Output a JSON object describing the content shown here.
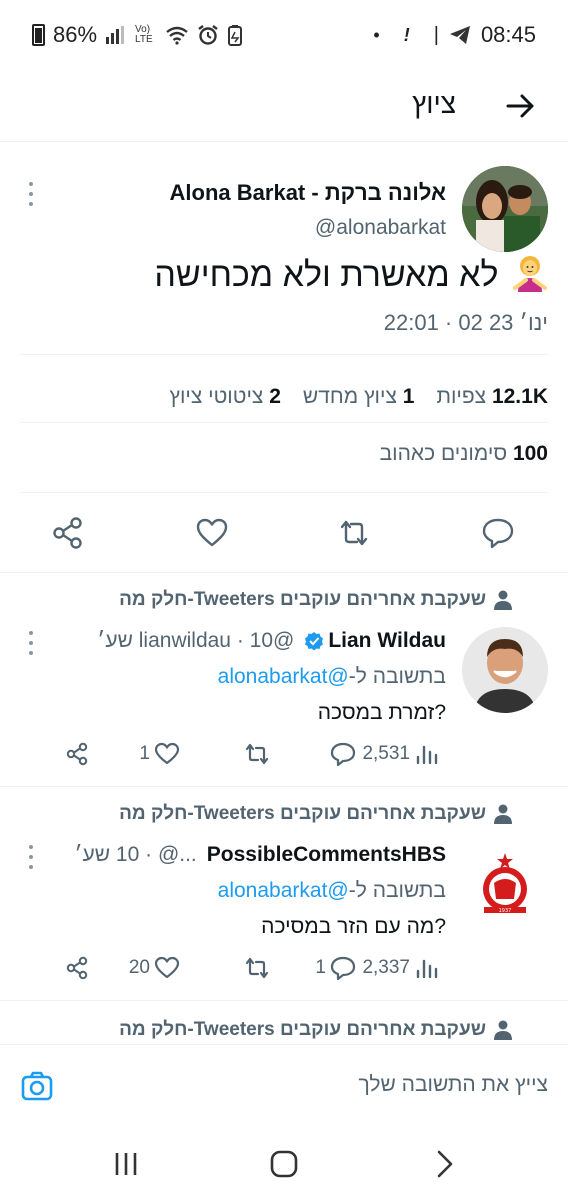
{
  "status_bar": {
    "battery": "86%",
    "time": "08:45",
    "signal_text": "Vo) LTE"
  },
  "header": {
    "title": "ציוץ",
    "back_icon": "arrow-right-icon"
  },
  "tweet": {
    "author_name": "Alona Barkat - אלונה ברקת",
    "author_handle": "@alonabarkat",
    "text": "לא מאשרת ולא מכחישה",
    "emoji": "person-gesturing-no",
    "timestamp": "22:01 · 02 ינו׳ 23",
    "stats": {
      "views_value": "12.1K",
      "views_label": "צפיות",
      "retweets_value": "1",
      "retweets_label": "ציוץ מחדש",
      "quotes_value": "2",
      "quotes_label": "ציטוטי ציוץ",
      "likes_value": "100",
      "likes_label": "סימונים כאהוב"
    }
  },
  "replies": [
    {
      "social_context": "חלק מה-Tweeters שעקבת אחריהם עוקבים",
      "author_name": "Lian Wildau",
      "verified": true,
      "meta": "@lianwildau · 10 שע׳",
      "reply_to_prefix": "בתשובה ל-",
      "reply_to_handle": "@alonabarkat",
      "text": "זמרת במסכה?",
      "views": "2,531",
      "replies_count": "",
      "retweets_count": "",
      "likes_count": "1"
    },
    {
      "social_context": "חלק מה-Tweeters שעקבת אחריהם עוקבים",
      "author_name": "PossibleCommentsHBS",
      "verified": false,
      "meta": "...@ · 10 שע׳",
      "reply_to_prefix": "בתשובה ל-",
      "reply_to_handle": "@alonabarkat",
      "text": "מה עם הזר במסיכה?",
      "views": "2,337",
      "replies_count": "1",
      "retweets_count": "",
      "likes_count": "20"
    },
    {
      "social_context": "חלק מה-Tweeters שעקבת אחריהם עוקבים"
    }
  ],
  "composer": {
    "placeholder": "צייץ את התשובה שלך"
  },
  "colors": {
    "accent": "#1d9bf0",
    "text_primary": "#0f1419",
    "text_secondary": "#536471",
    "divider": "#eff3f4"
  }
}
